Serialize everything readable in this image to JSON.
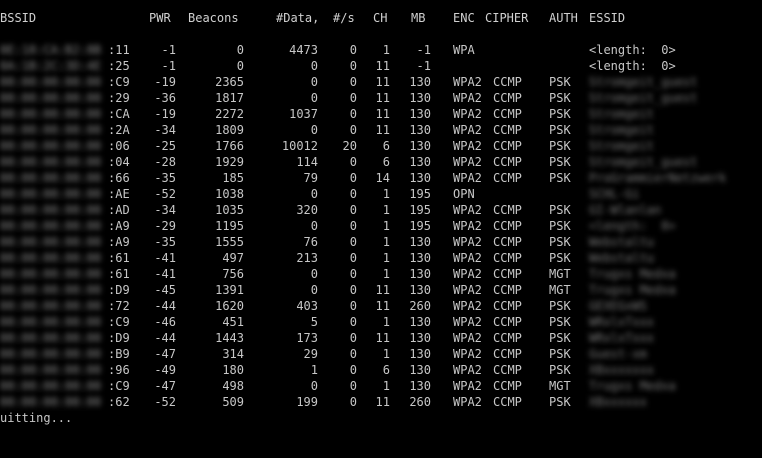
{
  "header": {
    "bssid": "BSSID",
    "pwr": "PWR",
    "beacons": "Beacons",
    "data": "#Data,",
    "per_s": "#/s",
    "ch": "CH",
    "mb": "MB",
    "enc": "ENC",
    "cipher": "CIPHER",
    "auth": "AUTH",
    "essid": "ESSID"
  },
  "rows": [
    {
      "bssid_hidden": "0E:18:CA:B2:8B",
      "bssid_suffix": ":11",
      "pwr": "-1",
      "beacons": "0",
      "data": "4473",
      "per_s": "0",
      "ch": "1",
      "mb": "-1",
      "enc": "WPA",
      "cipher": "",
      "auth": "",
      "essid": "<length:  0>",
      "essid_blurred": false
    },
    {
      "bssid_hidden": "0A:1B:2C:3D:4E",
      "bssid_suffix": ":25",
      "pwr": "-1",
      "beacons": "0",
      "data": "0",
      "per_s": "0",
      "ch": "11",
      "mb": "-1",
      "enc": "",
      "cipher": "",
      "auth": "",
      "essid": "<length:  0>",
      "essid_blurred": false
    },
    {
      "bssid_hidden": "00:00:00:00:00",
      "bssid_suffix": ":C9",
      "pwr": "-19",
      "beacons": "2365",
      "data": "0",
      "per_s": "0",
      "ch": "11",
      "mb": "130",
      "enc": "WPA2",
      "cipher": "CCMP",
      "auth": "PSK",
      "essid": "Stromgeit_guest",
      "essid_blurred": true
    },
    {
      "bssid_hidden": "00:00:00:00:00",
      "bssid_suffix": ":29",
      "pwr": "-36",
      "beacons": "1817",
      "data": "0",
      "per_s": "0",
      "ch": "11",
      "mb": "130",
      "enc": "WPA2",
      "cipher": "CCMP",
      "auth": "PSK",
      "essid": "Stromgeit_guest",
      "essid_blurred": true
    },
    {
      "bssid_hidden": "00:00:00:00:00",
      "bssid_suffix": ":CA",
      "pwr": "-19",
      "beacons": "2272",
      "data": "1037",
      "per_s": "0",
      "ch": "11",
      "mb": "130",
      "enc": "WPA2",
      "cipher": "CCMP",
      "auth": "PSK",
      "essid": "Stromgeit",
      "essid_blurred": true
    },
    {
      "bssid_hidden": "00:00:00:00:00",
      "bssid_suffix": ":2A",
      "pwr": "-34",
      "beacons": "1809",
      "data": "0",
      "per_s": "0",
      "ch": "11",
      "mb": "130",
      "enc": "WPA2",
      "cipher": "CCMP",
      "auth": "PSK",
      "essid": "Stromgeit",
      "essid_blurred": true
    },
    {
      "bssid_hidden": "00:00:00:00:00",
      "bssid_suffix": ":06",
      "pwr": "-25",
      "beacons": "1766",
      "data": "10012",
      "per_s": "20",
      "ch": "6",
      "mb": "130",
      "enc": "WPA2",
      "cipher": "CCMP",
      "auth": "PSK",
      "essid": "Stromgeit",
      "essid_blurred": true
    },
    {
      "bssid_hidden": "00:00:00:00:00",
      "bssid_suffix": ":04",
      "pwr": "-28",
      "beacons": "1929",
      "data": "114",
      "per_s": "0",
      "ch": "6",
      "mb": "130",
      "enc": "WPA2",
      "cipher": "CCMP",
      "auth": "PSK",
      "essid": "Stromgeit_guest",
      "essid_blurred": true
    },
    {
      "bssid_hidden": "00:00:00:00:00",
      "bssid_suffix": ":66",
      "pwr": "-35",
      "beacons": "185",
      "data": "79",
      "per_s": "0",
      "ch": "14",
      "mb": "130",
      "enc": "WPA2",
      "cipher": "CCMP",
      "auth": "PSK",
      "essid": "ProGrammierNetzwerk",
      "essid_blurred": true
    },
    {
      "bssid_hidden": "00:00:00:00:00",
      "bssid_suffix": ":AE",
      "pwr": "-52",
      "beacons": "1038",
      "data": "0",
      "per_s": "0",
      "ch": "1",
      "mb": "195",
      "enc": "OPN",
      "cipher": "",
      "auth": "",
      "essid": "SCHL-Gi",
      "essid_blurred": true
    },
    {
      "bssid_hidden": "00:00:00:00:00",
      "bssid_suffix": ":AD",
      "pwr": "-34",
      "beacons": "1035",
      "data": "320",
      "per_s": "0",
      "ch": "1",
      "mb": "195",
      "enc": "WPA2",
      "cipher": "CCMP",
      "auth": "PSK",
      "essid": "GI-Wlanlan",
      "essid_blurred": true
    },
    {
      "bssid_hidden": "00:00:00:00:00",
      "bssid_suffix": ":A9",
      "pwr": "-29",
      "beacons": "1195",
      "data": "0",
      "per_s": "0",
      "ch": "1",
      "mb": "195",
      "enc": "WPA2",
      "cipher": "CCMP",
      "auth": "PSK",
      "essid": "<length:  0>",
      "essid_blurred": true
    },
    {
      "bssid_hidden": "00:00:00:00:00",
      "bssid_suffix": ":A9",
      "pwr": "-35",
      "beacons": "1555",
      "data": "76",
      "per_s": "0",
      "ch": "1",
      "mb": "130",
      "enc": "WPA2",
      "cipher": "CCMP",
      "auth": "PSK",
      "essid": "Webstaltu",
      "essid_blurred": true
    },
    {
      "bssid_hidden": "00:00:00:00:00",
      "bssid_suffix": ":61",
      "pwr": "-41",
      "beacons": "497",
      "data": "213",
      "per_s": "0",
      "ch": "1",
      "mb": "130",
      "enc": "WPA2",
      "cipher": "CCMP",
      "auth": "PSK",
      "essid": "Webstaltu",
      "essid_blurred": true
    },
    {
      "bssid_hidden": "00:00:00:00:00",
      "bssid_suffix": ":61",
      "pwr": "-41",
      "beacons": "756",
      "data": "0",
      "per_s": "0",
      "ch": "1",
      "mb": "130",
      "enc": "WPA2",
      "cipher": "CCMP",
      "auth": "MGT",
      "essid": "Trugxs Medxa",
      "essid_blurred": true
    },
    {
      "bssid_hidden": "00:00:00:00:00",
      "bssid_suffix": ":D9",
      "pwr": "-45",
      "beacons": "1391",
      "data": "0",
      "per_s": "0",
      "ch": "11",
      "mb": "130",
      "enc": "WPA2",
      "cipher": "CCMP",
      "auth": "MGT",
      "essid": "Trugxs Medxa",
      "essid_blurred": true
    },
    {
      "bssid_hidden": "00:00:00:00:00",
      "bssid_suffix": ":72",
      "pwr": "-44",
      "beacons": "1620",
      "data": "403",
      "per_s": "0",
      "ch": "11",
      "mb": "260",
      "enc": "WPA2",
      "cipher": "CCMP",
      "auth": "PSK",
      "essid": "GEXEGxWS",
      "essid_blurred": true
    },
    {
      "bssid_hidden": "00:00:00:00:00",
      "bssid_suffix": ":C9",
      "pwr": "-46",
      "beacons": "451",
      "data": "5",
      "per_s": "0",
      "ch": "1",
      "mb": "130",
      "enc": "WPA2",
      "cipher": "CCMP",
      "auth": "PSK",
      "essid": "WRxlxTxxx",
      "essid_blurred": true
    },
    {
      "bssid_hidden": "00:00:00:00:00",
      "bssid_suffix": ":D9",
      "pwr": "-44",
      "beacons": "1443",
      "data": "173",
      "per_s": "0",
      "ch": "11",
      "mb": "130",
      "enc": "WPA2",
      "cipher": "CCMP",
      "auth": "PSK",
      "essid": "WRxlxTxxx",
      "essid_blurred": true
    },
    {
      "bssid_hidden": "00:00:00:00:00",
      "bssid_suffix": ":B9",
      "pwr": "-47",
      "beacons": "314",
      "data": "29",
      "per_s": "0",
      "ch": "1",
      "mb": "130",
      "enc": "WPA2",
      "cipher": "CCMP",
      "auth": "PSK",
      "essid": "Guest-xm",
      "essid_blurred": true
    },
    {
      "bssid_hidden": "00:00:00:00:00",
      "bssid_suffix": ":96",
      "pwr": "-49",
      "beacons": "180",
      "data": "1",
      "per_s": "0",
      "ch": "6",
      "mb": "130",
      "enc": "WPA2",
      "cipher": "CCMP",
      "auth": "PSK",
      "essid": "XBxxxxxxx",
      "essid_blurred": true
    },
    {
      "bssid_hidden": "00:00:00:00:00",
      "bssid_suffix": ":C9",
      "pwr": "-47",
      "beacons": "498",
      "data": "0",
      "per_s": "0",
      "ch": "1",
      "mb": "130",
      "enc": "WPA2",
      "cipher": "CCMP",
      "auth": "MGT",
      "essid": "Trugxs Medxa",
      "essid_blurred": true
    },
    {
      "bssid_hidden": "00:00:00:00:00",
      "bssid_suffix": ":62",
      "pwr": "-52",
      "beacons": "509",
      "data": "199",
      "per_s": "0",
      "ch": "11",
      "mb": "260",
      "enc": "WPA2",
      "cipher": "CCMP",
      "auth": "PSK",
      "essid": "XBxxxxxx",
      "essid_blurred": true
    }
  ],
  "footer": {
    "status": "uitting..."
  }
}
